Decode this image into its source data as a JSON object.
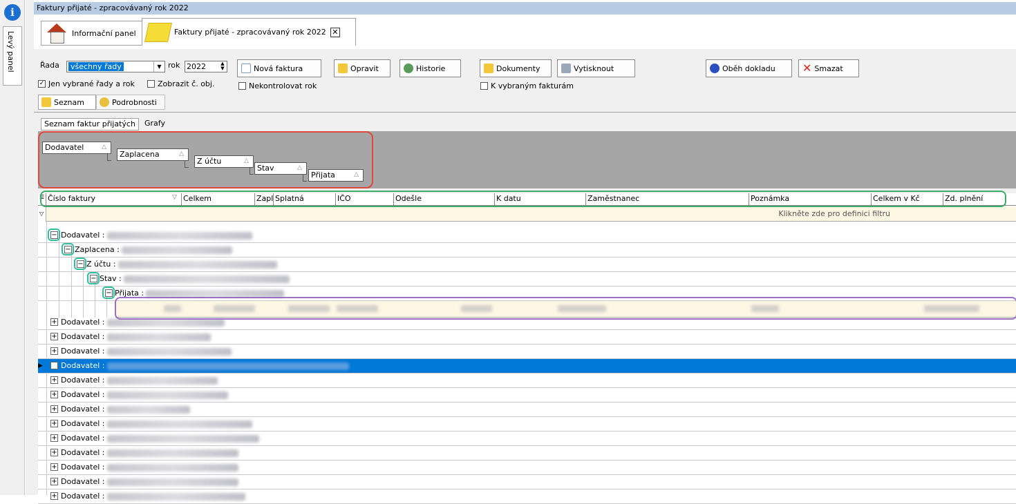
{
  "left_panel": {
    "info_icon": "i",
    "levy_panel_label": "Levý panel"
  },
  "window_title": "Faktury přijaté - zpracovávaný rok 2022",
  "tabs": [
    {
      "label": "Informační panel",
      "icon": "house-icon"
    },
    {
      "label": "Faktury přijaté - zpracovávaný rok 2022",
      "icon": "folder-icon",
      "close": "✕"
    }
  ],
  "toolbar": {
    "rada_label": "Řada",
    "rada_value": "všechny řady",
    "rok_label": "rok",
    "rok_value": "2022",
    "jen_vybrane_label": "Jen vybrané řady a rok",
    "zobrazit_label": "Zobrazit č. obj.",
    "nova_faktura": "Nová faktura",
    "nekontrolovat_label": "Nekontrolovat rok",
    "opravit": "Opravit",
    "historie": "Historie",
    "dokumenty": "Dokumenty",
    "vytisknout": "Vytisknout",
    "k_vybranym_label": "K vybraným fakturám",
    "obeh_dokladu": "Oběh dokladu",
    "smazat": "Smazat",
    "smazat_color": "#e02020"
  },
  "subtabs": {
    "seznam": "Seznam",
    "podrobnosti": "Podrobnosti"
  },
  "innertabs": {
    "seznam_faktur": "Seznam faktur přijatých",
    "grafy": "Grafy"
  },
  "group_by": [
    "Dodavatel",
    "Zaplacena",
    "Z účtu",
    "Stav",
    "Přijata"
  ],
  "columns": [
    "Číslo faktury",
    "Celkem",
    "Zapla",
    "Splatná",
    "IČO",
    "Odešle",
    "K datu",
    "Zaměstnanec",
    "Poznámka",
    "Celkem v Kč",
    "Zd. plnění"
  ],
  "filter_hint": "Klikněte zde pro definici filtru",
  "tree": {
    "dodavatel": "Dodavatel :",
    "zaplacena": "Zaplacena :",
    "z_uctu": "Z účtu :",
    "stav": "Stav :",
    "prijata": "Přijata :"
  },
  "collapsed_rows": [
    "Dodavatel :",
    "Dodavatel :",
    "Dodavatel :",
    "Dodavatel :",
    "Dodavatel :",
    "Dodavatel :",
    "Dodavatel :",
    "Dodavatel :",
    "Dodavatel :",
    "Dodavatel :",
    "Dodavatel :",
    "Dodavatel :",
    "Dodavatel :"
  ],
  "colors": {
    "highlight_red": "#e0463c",
    "highlight_green": "#3aad6a",
    "highlight_purple": "#9a6fc4",
    "highlight_teal": "#2fbfa0",
    "selection_blue": "#0078d7"
  }
}
